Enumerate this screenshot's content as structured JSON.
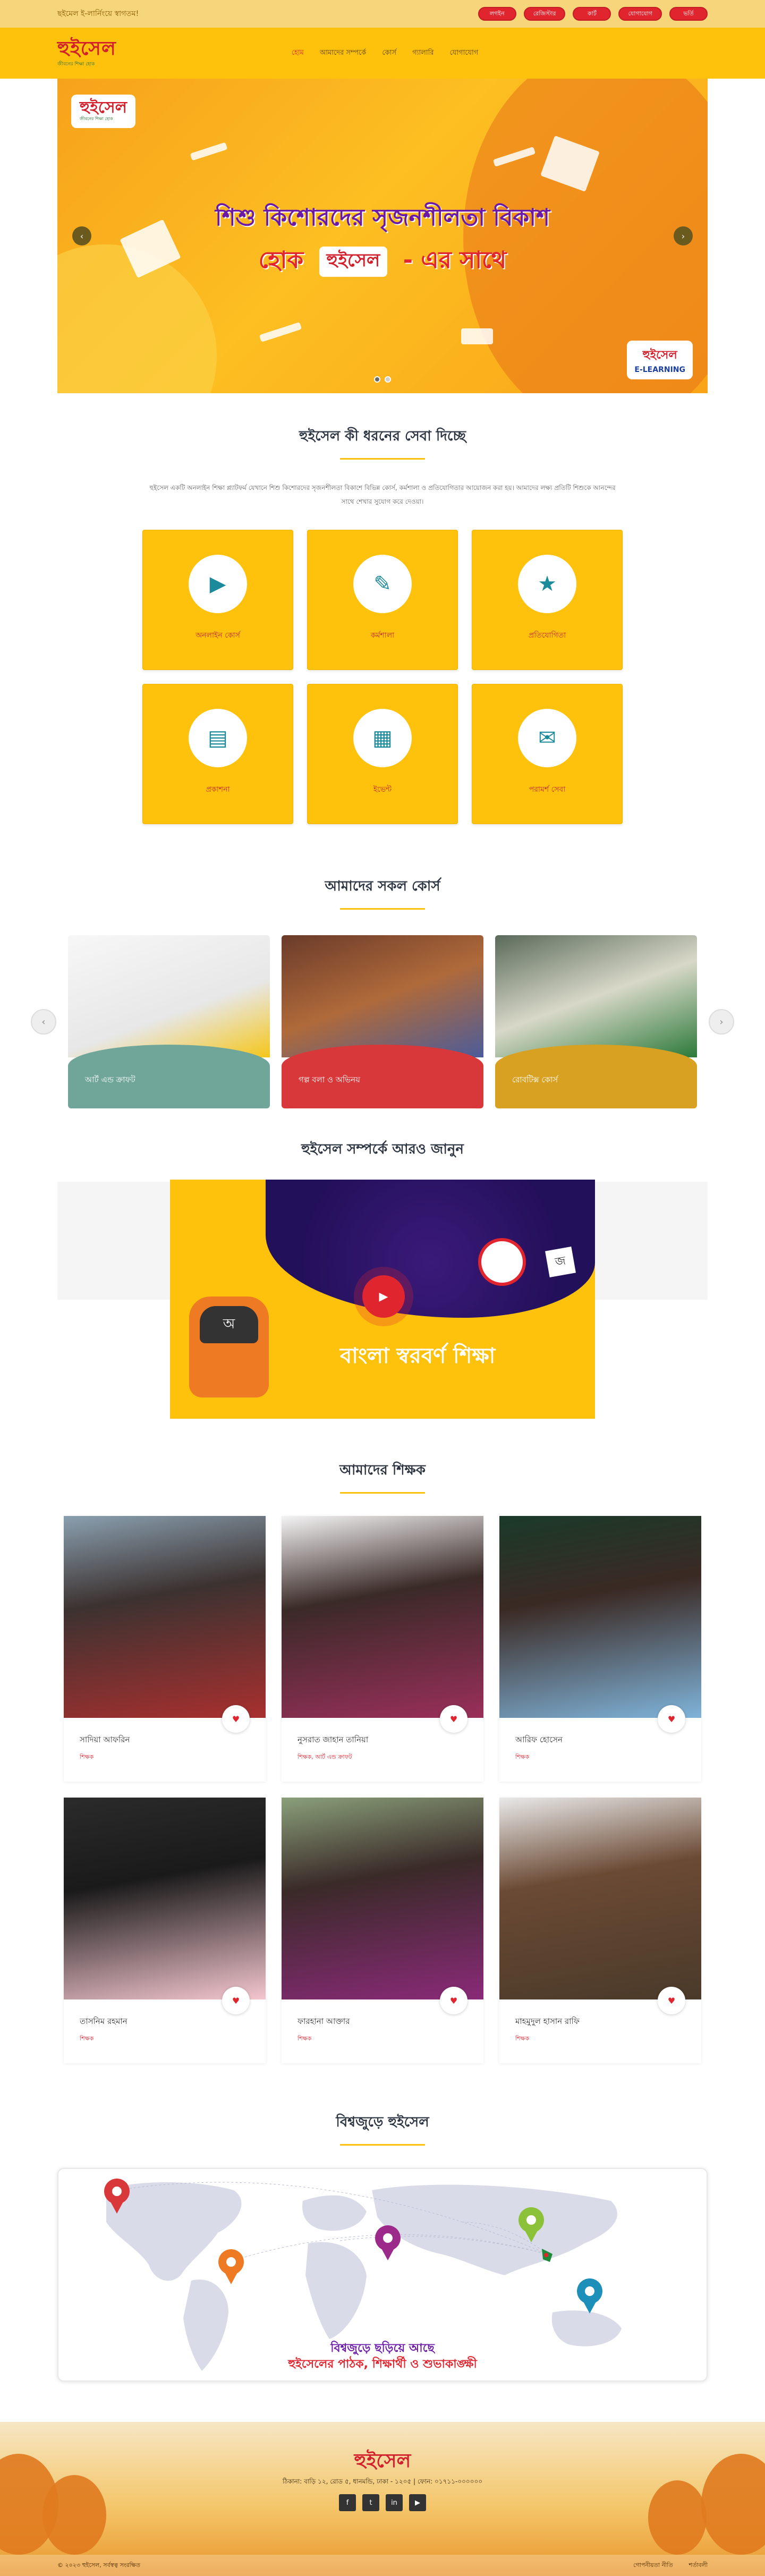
{
  "topbar": {
    "message": "ছইমেল ই-লার্নিংয়ে স্বাগতম!",
    "pills": [
      "লগইন",
      "রেজিস্টার",
      "কার্ট",
      "যোগাযোগ",
      "ভর্তি"
    ]
  },
  "header": {
    "logo": "হুইসেল",
    "logo_sub": "জীবনের শিক্ষা হোক",
    "nav": [
      "হোম",
      "আমাদের সম্পর্কে",
      "কোর্স",
      "গ্যালারি",
      "যোগাযোগ"
    ]
  },
  "hero": {
    "logo": "হুইসেল",
    "logo_sub": "জীবনের শিক্ষা হোক",
    "headline_line1": "শিশু কিশোরদের সৃজনশীলতা বিকাশ",
    "headline_prefix": "হোক",
    "headline_brand": "হুইসেল",
    "headline_suffix": "- এর সাথে",
    "badge_brand": "হুইসেল",
    "badge_text": "E-LEARNING"
  },
  "services": {
    "title": "হুইসেল কী ধরনের সেবা দিচ্ছে",
    "intro": "হুইসেল একটি অনলাইন শিক্ষা প্ল্যাটফর্ম যেখানে শিশু কিশোরদের সৃজনশীলতা বিকাশে বিভিন্ন কোর্স, কর্মশালা ও প্রতিযোগিতার আয়োজন করা হয়। আমাদের লক্ষ্য প্রতিটি শিশুকে আনন্দের সাথে শেখার সুযোগ করে দেওয়া।",
    "items": [
      {
        "label": "অনলাইন কোর্স",
        "icon": "video-icon"
      },
      {
        "label": "কর্মশালা",
        "icon": "tools-icon"
      },
      {
        "label": "প্রতিযোগিতা",
        "icon": "trophy-icon"
      },
      {
        "label": "প্রকাশনা",
        "icon": "book-icon"
      },
      {
        "label": "ইভেন্ট",
        "icon": "calendar-icon"
      },
      {
        "label": "পরামর্শ সেবা",
        "icon": "chat-icon"
      }
    ]
  },
  "courses": {
    "title": "আমাদের সকল কোর্স",
    "items": [
      {
        "label": "আর্ট এন্ড ক্রাফট"
      },
      {
        "label": "গল্প বলা ও অভিনয়"
      },
      {
        "label": "রোবটিক্স কোর্স"
      }
    ]
  },
  "video": {
    "title": "হুইসেল সম্পর্কে আরও জানুন",
    "overlay_text": "বাংলা স্বরবর্ণ শিক্ষা",
    "bag_letter": "অ",
    "letter_card": "জ"
  },
  "team": {
    "title": "আমাদের শিক্ষক",
    "members": [
      {
        "name": "সাদিয়া আফরিন",
        "role": "শিক্ষক"
      },
      {
        "name": "নুসরাত জাহান তানিয়া",
        "role": "শিক্ষক, আর্ট এন্ড ক্রাফট"
      },
      {
        "name": "আরিফ হোসেন",
        "role": "শিক্ষক"
      },
      {
        "name": "তাসনিম রহমান",
        "role": "শিক্ষক"
      },
      {
        "name": "ফারহানা আক্তার",
        "role": "শিক্ষক"
      },
      {
        "name": "মাহমুদুল হাসান রাফি",
        "role": "শিক্ষক"
      }
    ]
  },
  "presence": {
    "title": "বিশ্বজুড়ে হুইসেল",
    "caption_line1": "বিশ্বজুড়ে ছড়িয়ে আছে",
    "caption_line2": "হুইসেলের পাঠক, শিক্ষার্থী ও শুভাকাঙ্ক্ষী"
  },
  "footer": {
    "logo": "হুইসেল",
    "address": "ঠিকানা: বাড়ি ১২, রোড ৫, ধানমন্ডি, ঢাকা - ১২০৫ | ফোন: ০১৭১১-০০০০০০",
    "socials": [
      "f",
      "t",
      "in",
      "▶"
    ],
    "copyright": "© ২০২৩ হুইসেল, সর্বস্বত্ব সংরক্ষিত",
    "links": [
      "গোপনীয়তা নীতি",
      "শর্তাবলী"
    ]
  },
  "colors": {
    "accent": "#fec20c",
    "brand_red": "#e0252f"
  }
}
